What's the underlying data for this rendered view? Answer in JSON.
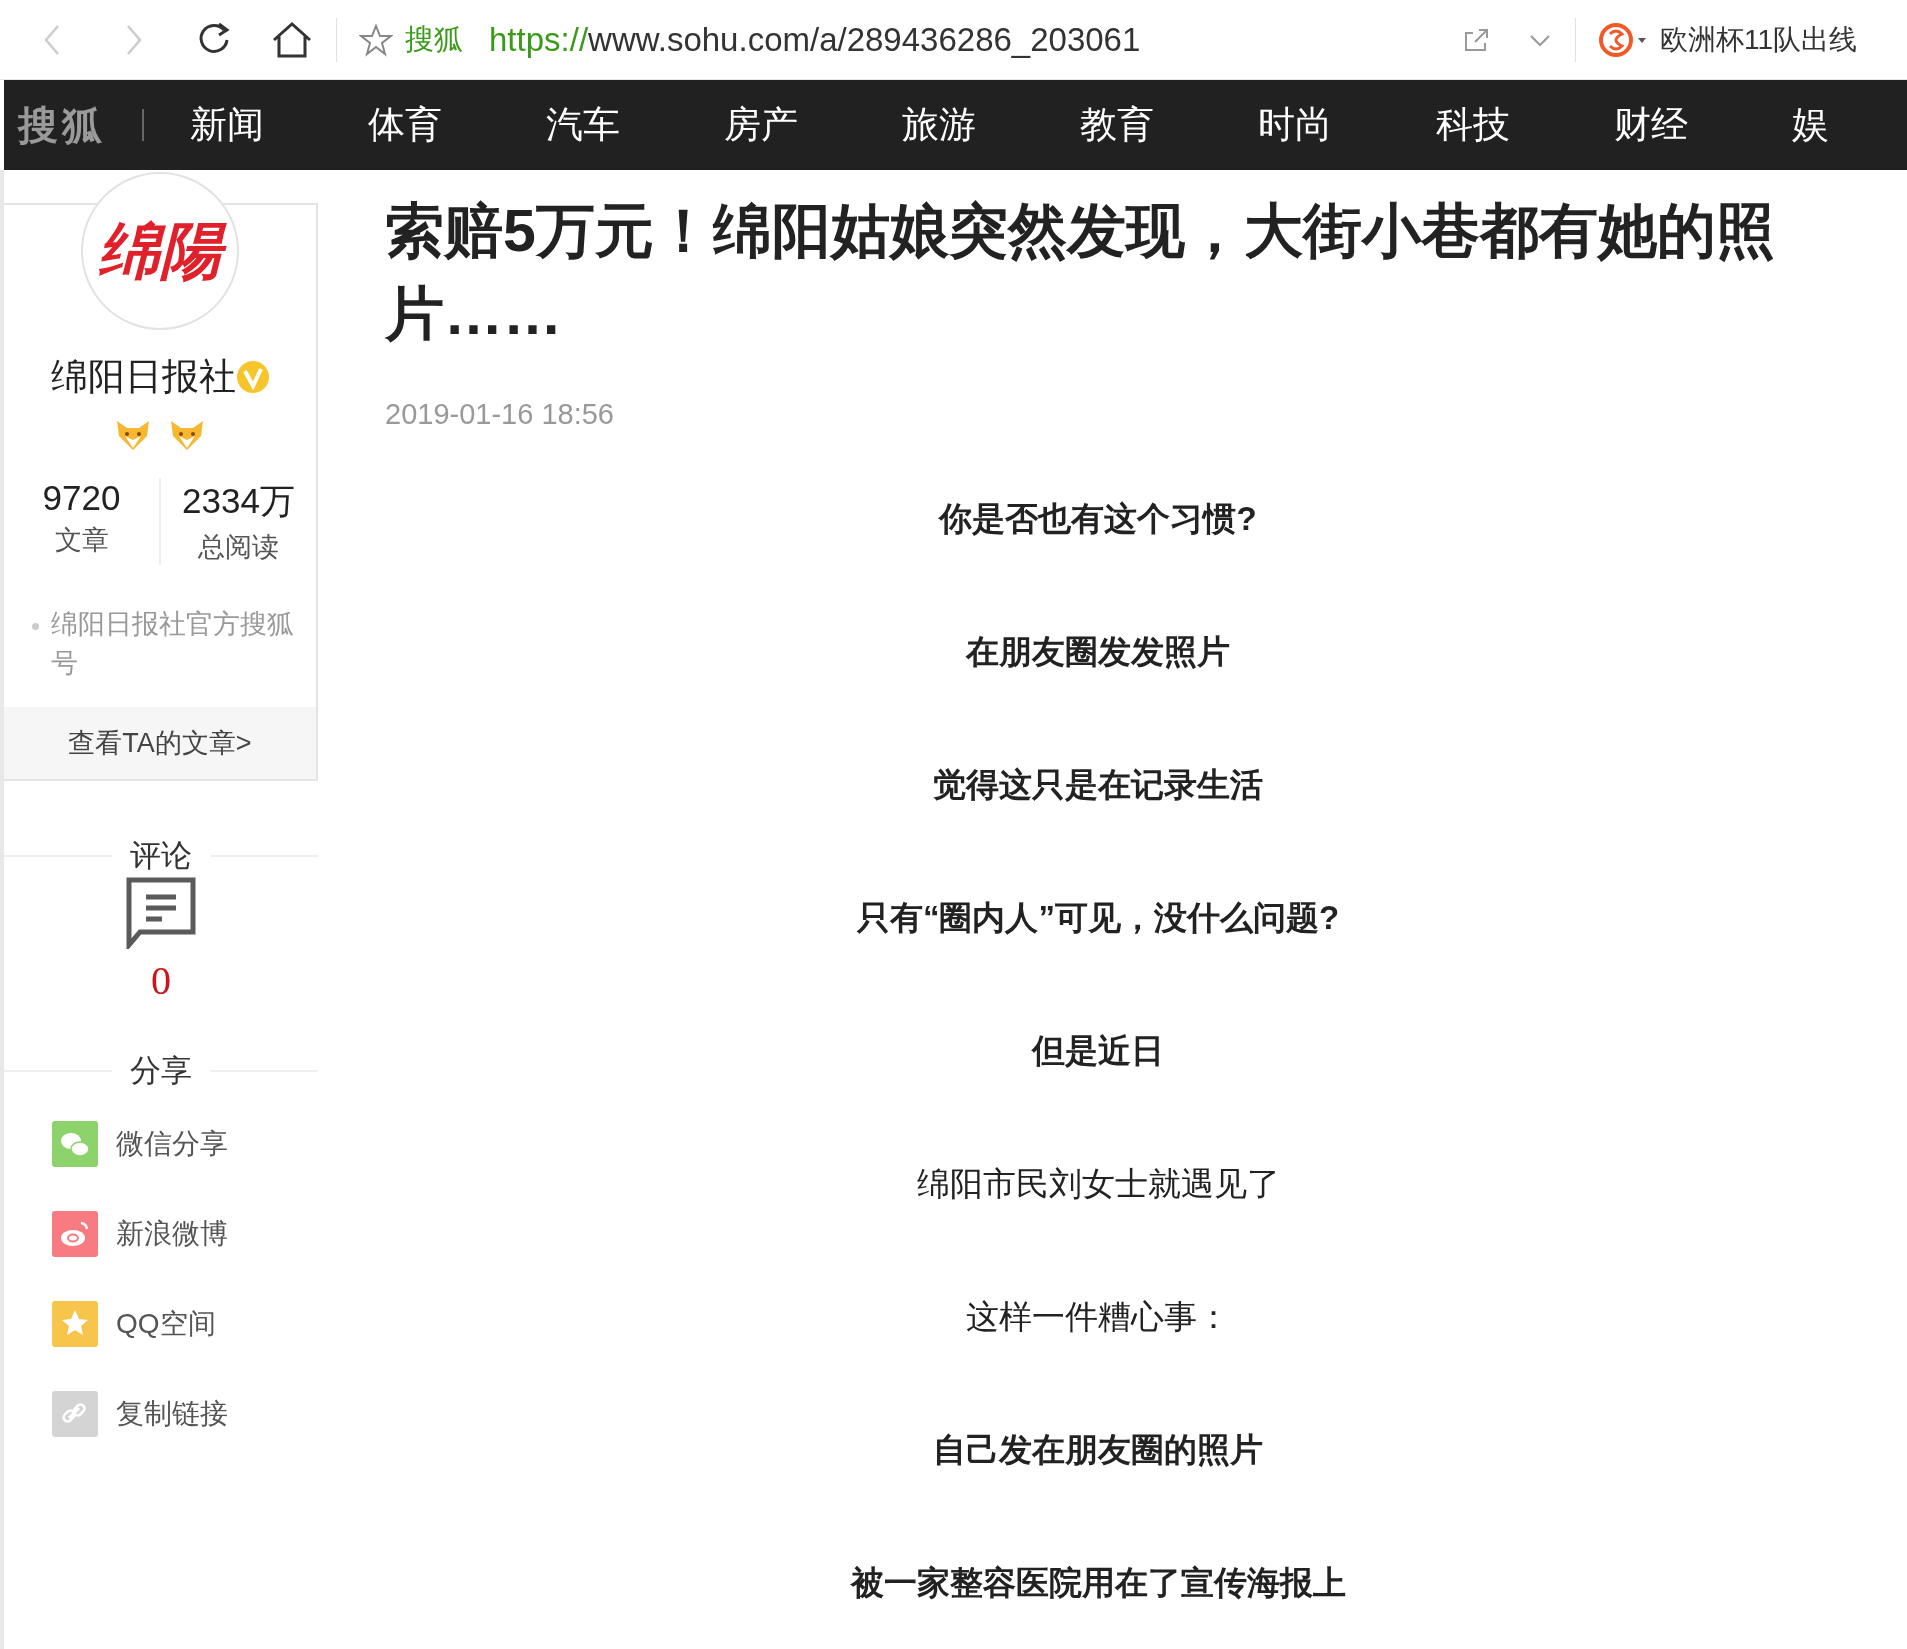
{
  "browser": {
    "site_name": "搜狐",
    "url_scheme": "https://",
    "url_address": "www.sohu.com/a/289436286_203061",
    "hot_search": "欧洲杯11队出线"
  },
  "nav": {
    "logo": "搜狐",
    "items": [
      {
        "label": "新闻"
      },
      {
        "label": "体育"
      },
      {
        "label": "汽车"
      },
      {
        "label": "房产"
      },
      {
        "label": "旅游"
      },
      {
        "label": "教育"
      },
      {
        "label": "时尚"
      },
      {
        "label": "科技"
      },
      {
        "label": "财经"
      },
      {
        "label": "娱"
      }
    ]
  },
  "author": {
    "avatar_text": "绵陽",
    "name": "绵阳日报社",
    "verified": true,
    "stats": [
      {
        "value": "9720",
        "label": "文章"
      },
      {
        "value": "2334万",
        "label": "总阅读"
      }
    ],
    "description": "绵阳日报社官方搜狐号",
    "link": "查看TA的文章>"
  },
  "comments": {
    "heading": "评论",
    "count": "0"
  },
  "share": {
    "heading": "分享",
    "items": [
      {
        "kind": "wechat",
        "label": "微信分享",
        "color": "#8cd36b"
      },
      {
        "kind": "weibo",
        "label": "新浪微博",
        "color": "#f77b80"
      },
      {
        "kind": "qzone",
        "label": "QQ空间",
        "color": "#f8c54c"
      },
      {
        "kind": "link",
        "label": "复制链接",
        "color": "#d4d4d4"
      }
    ]
  },
  "article": {
    "title": "索赔5万元！绵阳姑娘突然发现，大街小巷都有她的照片……",
    "date": "2019-01-16 18:56",
    "paragraphs": [
      {
        "text": "你是否也有这个习惯?",
        "bold": true
      },
      {
        "text": "在朋友圈发发照片",
        "bold": true
      },
      {
        "text": "觉得这只是在记录生活",
        "bold": true
      },
      {
        "text": "只有“圈内人”可见，没什么问题?",
        "bold": true
      },
      {
        "text": "但是近日",
        "bold": true
      },
      {
        "text": "绵阳市民刘女士就遇见了",
        "bold": false
      },
      {
        "text": "这样一件糟心事：",
        "bold": false
      },
      {
        "text": "自己发在朋友圈的照片",
        "bold": true
      },
      {
        "text": "被一家整容医院用在了宣传海报上",
        "bold": true
      }
    ]
  }
}
